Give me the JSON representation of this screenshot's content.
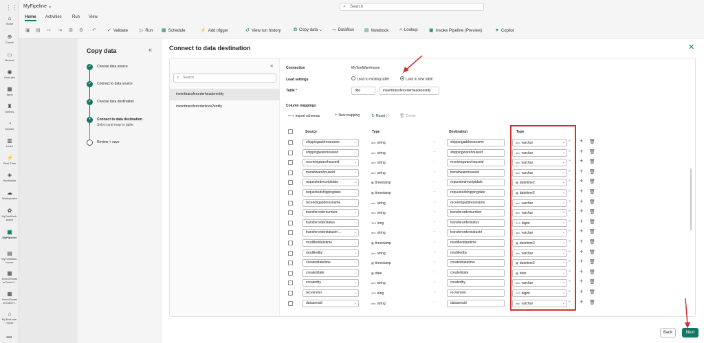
{
  "nav": {
    "items": [
      {
        "label": "Home",
        "icon": "home-icon",
        "glyph": "⌂"
      },
      {
        "label": "Create",
        "icon": "create-icon",
        "glyph": "⊕"
      },
      {
        "label": "Browse",
        "icon": "browse-icon",
        "glyph": "▭"
      },
      {
        "label": "OneLake",
        "icon": "onelake-icon",
        "glyph": "◉"
      },
      {
        "label": "Apps",
        "icon": "apps-icon",
        "glyph": "▦"
      },
      {
        "label": "Metrics",
        "icon": "metrics-icon",
        "glyph": "♜"
      },
      {
        "label": "Monitor",
        "icon": "monitor-icon",
        "glyph": "◔"
      },
      {
        "label": "Learn",
        "icon": "learn-icon",
        "glyph": "▥"
      },
      {
        "label": "Real-Time",
        "icon": "realtime-icon",
        "glyph": "⚡"
      },
      {
        "label": "Workloads",
        "icon": "workloads-icon",
        "glyph": "◈"
      },
      {
        "label": "Workspaces",
        "icon": "workspaces-icon",
        "glyph": "☁"
      },
      {
        "label": "MyTestWork-space",
        "icon": "workspace-icon",
        "glyph": "✿"
      },
      {
        "label": "MyPipeline",
        "icon": "pipeline-icon",
        "glyph": "▣"
      },
      {
        "label": "MyTestWare-house",
        "icon": "warehouse-icon",
        "glyph": "▤"
      },
      {
        "label": "InventTransf erOrderH...",
        "icon": "table-icon",
        "glyph": "▦"
      },
      {
        "label": "InventTransf erOrderH...",
        "icon": "table-icon",
        "glyph": "▦"
      },
      {
        "label": "MyTestLake-house",
        "icon": "lakehouse-icon",
        "glyph": "⌂"
      }
    ],
    "more": "•••"
  },
  "app": {
    "title": "MyFipeline ⌄",
    "search_placeholder": "Search"
  },
  "tabs": [
    "Home",
    "Activities",
    "Run",
    "View"
  ],
  "toolbar": {
    "validate": "Validate",
    "run": "Run",
    "schedule": "Schedule",
    "add_trigger": "Add trigger",
    "view_run_history": "View run history",
    "copy_data": "Copy data ⌄",
    "dataflow": "Dataflow",
    "notebook": "Notebook",
    "lookup": "Lookup",
    "invoke_pipeline": "Invoke Pipeline (Preview)",
    "copilot": "Copilot"
  },
  "wizard": {
    "title": "Copy data",
    "steps": [
      {
        "label": "Choose data source",
        "sub": ""
      },
      {
        "label": "Connect to data source",
        "sub": ""
      },
      {
        "label": "Choose data destination",
        "sub": ""
      },
      {
        "label": "Connect to data destination",
        "sub": "Select and map to table."
      },
      {
        "label": "Review + save",
        "sub": ""
      }
    ]
  },
  "main": {
    "title": "Connect to data destination",
    "table_search": "Search",
    "tables": [
      "inventtransferorderheaderentity",
      "inventtransferorderlinev2entity"
    ],
    "connection_label": "Connection",
    "connection_value": "MyTestWarehouse",
    "load_settings_label": "Load settings",
    "load_existing": "Load to existing table",
    "load_new": "Load to new table",
    "table_label": "Table",
    "table_required": "*",
    "schema": "dbo",
    "table_name": "inventtransferorderheaderentity",
    "column_mappings": "Column mappings",
    "import_schemas": "Import schemas",
    "new_mapping": "New mapping",
    "reset": "Reset",
    "delete": "Delete",
    "col_source": "Source",
    "col_type": "Type",
    "col_destination": "Destination",
    "col_dest_type": "Type",
    "rows": [
      {
        "source": "shippingaddressname",
        "stype": "string",
        "sicon": "abc",
        "dest": "shippingaddressname",
        "dtype": "varchar",
        "dicon": "abc"
      },
      {
        "source": "shippingwarehouseid",
        "stype": "string",
        "sicon": "abc",
        "dest": "shippingwarehouseid",
        "dtype": "varchar",
        "dicon": "abc"
      },
      {
        "source": "receivingwarehouseid",
        "stype": "string",
        "sicon": "abc",
        "dest": "receivingwarehouseid",
        "dtype": "varchar",
        "dicon": "abc"
      },
      {
        "source": "transitwarehouseid",
        "stype": "string",
        "sicon": "abc",
        "dest": "transitwarehouseid",
        "dtype": "varchar",
        "dicon": "abc"
      },
      {
        "source": "requestedreceiptdate",
        "stype": "timestamp",
        "sicon": "▦",
        "dest": "requestedreceiptdate",
        "dtype": "datetime2",
        "dicon": "▦"
      },
      {
        "source": "requestedshippingdate",
        "stype": "timestamp",
        "sicon": "▦",
        "dest": "requestedshippingdate",
        "dtype": "datetime2",
        "dicon": "▦"
      },
      {
        "source": "receivingaddressname",
        "stype": "string",
        "sicon": "abc",
        "dest": "receivingaddressname",
        "dtype": "varchar",
        "dicon": "abc"
      },
      {
        "source": "transferordernumber",
        "stype": "string",
        "sicon": "abc",
        "dest": "transferordernumber",
        "dtype": "varchar",
        "dicon": "abc"
      },
      {
        "source": "transferorderstatus",
        "stype": "long",
        "sicon": "123",
        "dest": "transferorderstatus",
        "dtype": "bigint",
        "dicon": "123"
      },
      {
        "source": "transferorderstatustri ...",
        "stype": "string",
        "sicon": "abc",
        "dest": "transferorderstatustri",
        "dtype": "varchar",
        "dicon": "abc"
      },
      {
        "source": "modifieddatetime",
        "stype": "timestamp",
        "sicon": "▦",
        "dest": "modifieddatetime",
        "dtype": "datetime2",
        "dicon": "▦"
      },
      {
        "source": "modifiedby",
        "stype": "string",
        "sicon": "abc",
        "dest": "modifiedby",
        "dtype": "varchar",
        "dicon": "abc"
      },
      {
        "source": "createddatetime",
        "stype": "timestamp",
        "sicon": "▦",
        "dest": "createddatetime",
        "dtype": "datetime2",
        "dicon": "▦"
      },
      {
        "source": "createddate",
        "stype": "date",
        "sicon": "▦",
        "dest": "createddate",
        "dtype": "date",
        "dicon": "▦"
      },
      {
        "source": "createdby",
        "stype": "string",
        "sicon": "abc",
        "dest": "createdby",
        "dtype": "varchar",
        "dicon": "abc"
      },
      {
        "source": "recversion",
        "stype": "long",
        "sicon": "123",
        "dest": "recversion",
        "dtype": "bigint",
        "dicon": "123"
      },
      {
        "source": "dataareaid",
        "stype": "string",
        "sicon": "abc",
        "dest": "dataareaid",
        "dtype": "varchar",
        "dicon": "abc"
      }
    ]
  },
  "footer": {
    "back": "Back",
    "next": "Next"
  },
  "colors": {
    "accent": "#117865",
    "highlight": "#d32f2f"
  }
}
